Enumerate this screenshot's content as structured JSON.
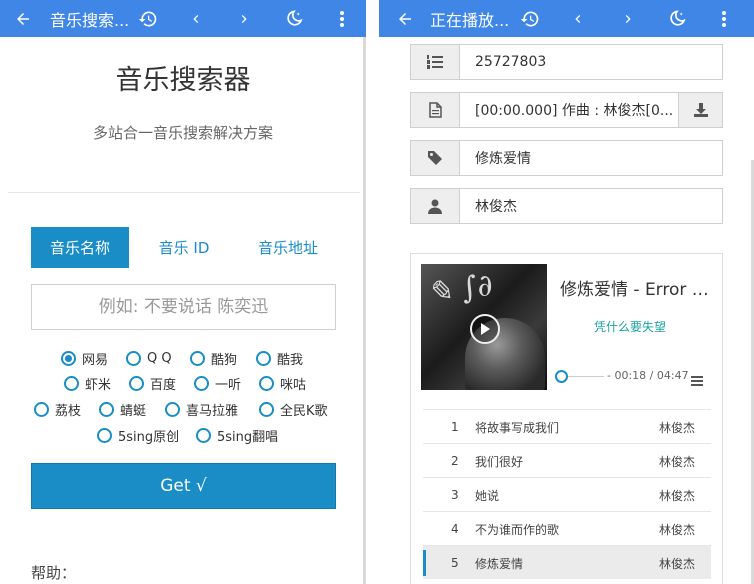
{
  "left": {
    "appbar": {
      "title": "音乐搜索..."
    },
    "title": "音乐搜索器",
    "subtitle": "多站合一音乐搜索解决方案",
    "tabs": [
      {
        "label": "音乐名称",
        "active": true
      },
      {
        "label": "音乐 ID",
        "active": false
      },
      {
        "label": "音乐地址",
        "active": false
      }
    ],
    "search": {
      "placeholder": "例如: 不要说话 陈奕迅",
      "value": ""
    },
    "sources": [
      {
        "label": "网易",
        "checked": true
      },
      {
        "label": "Q Q",
        "checked": false
      },
      {
        "label": "酷狗",
        "checked": false
      },
      {
        "label": "酷我",
        "checked": false
      },
      {
        "label": "虾米",
        "checked": false
      },
      {
        "label": "百度",
        "checked": false
      },
      {
        "label": "一听",
        "checked": false
      },
      {
        "label": "咪咕",
        "checked": false
      },
      {
        "label": "荔枝",
        "checked": false
      },
      {
        "label": "蜻蜓",
        "checked": false
      },
      {
        "label": "喜马拉雅",
        "checked": false
      },
      {
        "label": "全民K歌",
        "checked": false
      },
      {
        "label": "5sing原创",
        "checked": false
      },
      {
        "label": "5sing翻唱",
        "checked": false
      }
    ],
    "get_button": "Get √",
    "help": "帮助："
  },
  "right": {
    "appbar": {
      "title": "正在播放..."
    },
    "fields": {
      "id": "25727803",
      "lyric": "[00:00.000] 作曲 : 林俊杰[0...",
      "song": "修炼爱情",
      "artist": "林俊杰"
    },
    "player": {
      "title": "修炼爱情 - Error h...",
      "lyric_line": "凭什么要失望",
      "time": "- 00:18 / 04:47"
    },
    "playlist": [
      {
        "num": "1",
        "name": "将故事写成我们",
        "artist": "林俊杰",
        "current": false
      },
      {
        "num": "2",
        "name": "我们很好",
        "artist": "林俊杰",
        "current": false
      },
      {
        "num": "3",
        "name": "她说",
        "artist": "林俊杰",
        "current": false
      },
      {
        "num": "4",
        "name": "不为谁而作的歌",
        "artist": "林俊杰",
        "current": false
      },
      {
        "num": "5",
        "name": "修炼爱情",
        "artist": "林俊杰",
        "current": true
      }
    ]
  },
  "colors": {
    "appbar": "#3f86e6",
    "accent": "#1a8cc6",
    "lyric": "#1aa39f"
  },
  "icons": [
    "back-arrow-icon",
    "history-icon",
    "chevron-left-icon",
    "chevron-right-icon",
    "night-mode-icon",
    "more-vert-icon",
    "list-ol-icon",
    "file-icon",
    "download-icon",
    "tag-icon",
    "user-icon",
    "play-icon",
    "playlist-menu-icon"
  ]
}
